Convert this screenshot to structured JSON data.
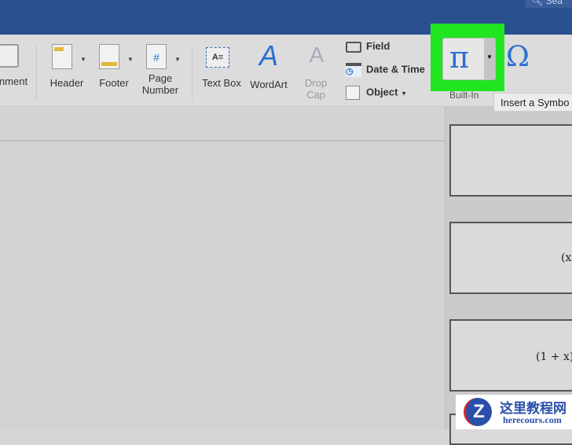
{
  "search": {
    "placeholder": "Sea"
  },
  "ribbon": {
    "comment": "nment",
    "header": "Header",
    "footer": "Footer",
    "page_number": "Page Number",
    "text_box": "Text Box",
    "wordart": "WordArt",
    "drop_cap": "Drop Cap",
    "field": "Field",
    "date_time": "Date & Time",
    "object": "Object",
    "equation_symbol": "π",
    "symbol_symbol": "Ω"
  },
  "tooltip": "Insert a Symbo",
  "panel": {
    "section": "Built-In",
    "equations": [
      "(x",
      "(1 + x)"
    ]
  },
  "watermark": {
    "title": "这里教程网",
    "url": "herecours.com"
  },
  "colors": {
    "highlight": "#22e522",
    "accent": "#2b6fd1",
    "titlebar": "#2b5090"
  }
}
